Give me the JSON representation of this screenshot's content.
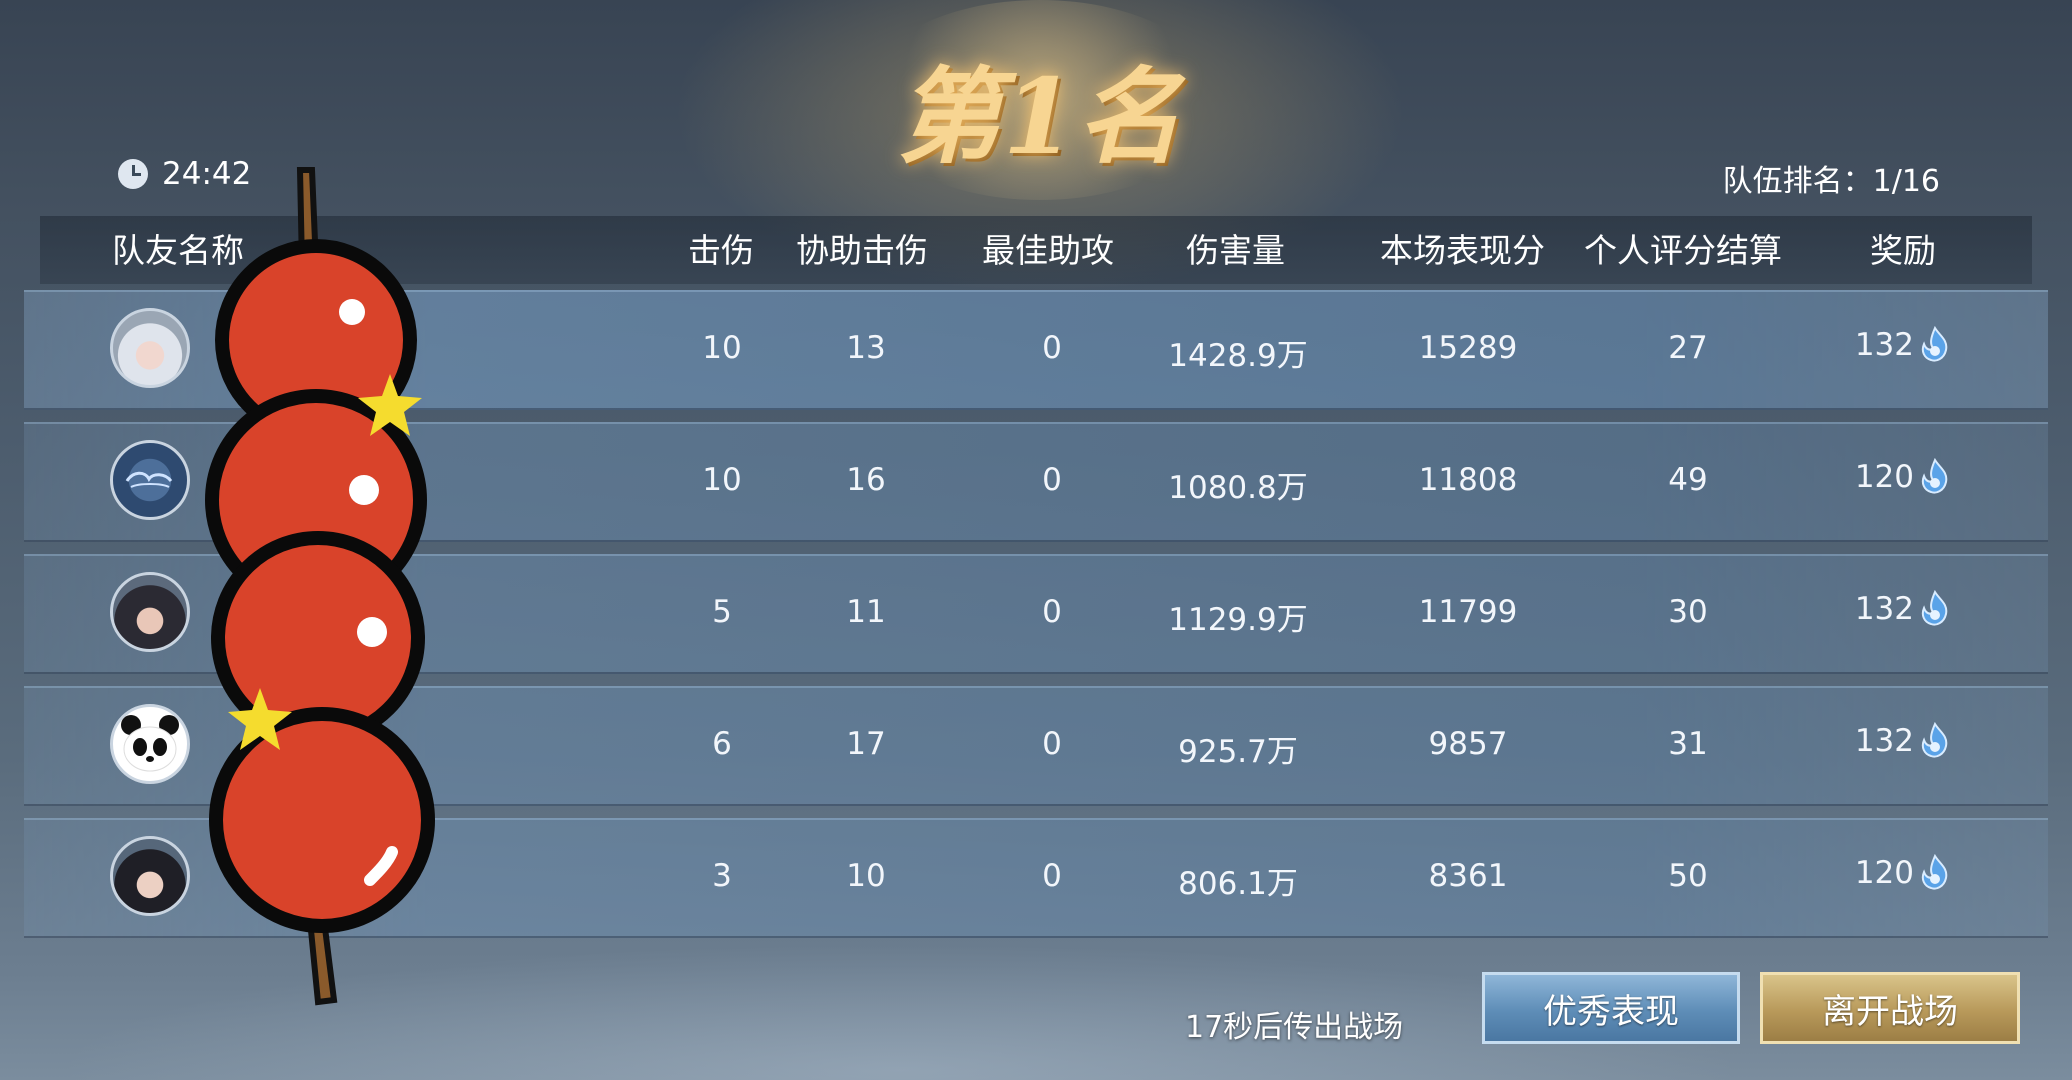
{
  "header": {
    "rank_title": "第1名",
    "timer": "24:42",
    "team_rank": "队伍排名：1/16"
  },
  "table": {
    "columns": [
      "队友名称",
      "击伤",
      "协助击伤",
      "最佳助攻",
      "伤害量",
      "本场表现分",
      "个人评分结算",
      "奖励"
    ],
    "rows": [
      {
        "avatar": "silver-hair-character-avatar",
        "kills": "10",
        "assists": "13",
        "best_assists": "0",
        "damage": "1428.9万",
        "performance": "15289",
        "rating": "27",
        "reward": "132"
      },
      {
        "avatar": "cloud-emblem-avatar",
        "kills": "10",
        "assists": "16",
        "best_assists": "0",
        "damage": "1080.8万",
        "performance": "11808",
        "rating": "49",
        "reward": "120"
      },
      {
        "avatar": "dark-hair-character-avatar",
        "kills": "5",
        "assists": "11",
        "best_assists": "0",
        "damage": "1129.9万",
        "performance": "11799",
        "rating": "30",
        "reward": "132"
      },
      {
        "avatar": "panda-avatar",
        "kills": "6",
        "assists": "17",
        "best_assists": "0",
        "damage": "925.7万",
        "performance": "9857",
        "rating": "31",
        "reward": "132"
      },
      {
        "avatar": "black-hair-character-avatar",
        "kills": "3",
        "assists": "10",
        "best_assists": "0",
        "damage": "806.1万",
        "performance": "8361",
        "rating": "50",
        "reward": "120"
      }
    ]
  },
  "footer": {
    "countdown": "17秒后传出战场",
    "excellent_button": "优秀表现",
    "leave_button": "离开战场"
  },
  "colors": {
    "candy_red": "#d9432a",
    "star_yellow": "#f5dc2e",
    "excellent_button": "#5e8db7",
    "leave_button": "#b8995a"
  },
  "icons": {
    "timer": "clock-icon",
    "reward": "currency-flame-icon"
  }
}
